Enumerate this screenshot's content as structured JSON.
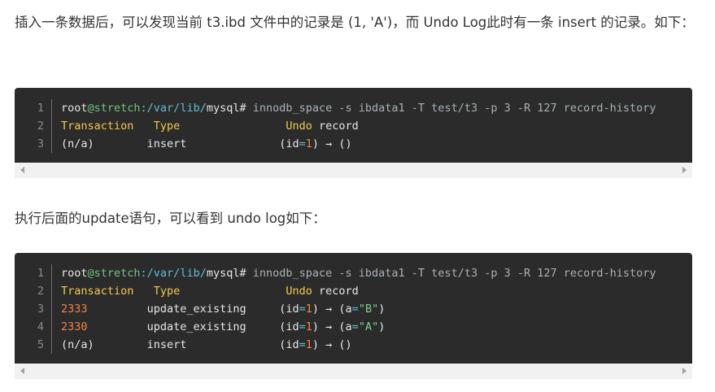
{
  "paragraphs": [
    "插入一条数据后，可以发现当前 t3.ibd 文件中的记录是 (1, 'A')，而 Undo Log此时有一条 insert 的记录。如下：",
    "执行后面的update语句，可以看到 undo log如下："
  ],
  "colors": {
    "plain": "#a9b1b6",
    "white": "#e6e6e6",
    "green": "#6ec77a",
    "teal": "#5fbfcf",
    "yellow": "#f2c94c",
    "orange": "#f0844a",
    "string": "#7ccf86"
  },
  "code_blocks": [
    {
      "lines": [
        [
          [
            "root",
            "white"
          ],
          [
            "@stretch",
            "green"
          ],
          [
            ":/var/lib/",
            "teal"
          ],
          [
            "mysql#",
            "white"
          ],
          [
            " innodb_space -s ibdata1 -T test/t3 -p 3 -R 127 record-history",
            "plain"
          ]
        ],
        [
          [
            "Transaction",
            "yellow"
          ],
          [
            "   ",
            "plain"
          ],
          [
            "Type",
            "yellow"
          ],
          [
            "                ",
            "plain"
          ],
          [
            "Undo",
            "yellow"
          ],
          [
            " record",
            "white"
          ]
        ],
        [
          [
            "(n/a)        insert              (id",
            "white"
          ],
          [
            "=",
            "teal"
          ],
          [
            "1",
            "orange"
          ],
          [
            ") → ()",
            "white"
          ]
        ]
      ]
    },
    {
      "lines": [
        [
          [
            "root",
            "white"
          ],
          [
            "@stretch",
            "green"
          ],
          [
            ":/var/lib/",
            "teal"
          ],
          [
            "mysql#",
            "white"
          ],
          [
            " innodb_space -s ibdata1 -T test/t3 -p 3 -R 127 record-history",
            "plain"
          ]
        ],
        [
          [
            "Transaction",
            "yellow"
          ],
          [
            "   ",
            "plain"
          ],
          [
            "Type",
            "yellow"
          ],
          [
            "                ",
            "plain"
          ],
          [
            "Undo",
            "yellow"
          ],
          [
            " record",
            "white"
          ]
        ],
        [
          [
            "2333",
            "orange"
          ],
          [
            "         update_existing     (id",
            "white"
          ],
          [
            "=",
            "teal"
          ],
          [
            "1",
            "orange"
          ],
          [
            ") → (a",
            "white"
          ],
          [
            "=",
            "teal"
          ],
          [
            "\"B\"",
            "string"
          ],
          [
            ")",
            "white"
          ]
        ],
        [
          [
            "2330",
            "orange"
          ],
          [
            "         update_existing     (id",
            "white"
          ],
          [
            "=",
            "teal"
          ],
          [
            "1",
            "orange"
          ],
          [
            ") → (a",
            "white"
          ],
          [
            "=",
            "teal"
          ],
          [
            "\"A\"",
            "string"
          ],
          [
            ")",
            "white"
          ]
        ],
        [
          [
            "(n/a)        insert              (id",
            "white"
          ],
          [
            "=",
            "teal"
          ],
          [
            "1",
            "orange"
          ],
          [
            ") → ()",
            "white"
          ]
        ]
      ]
    }
  ]
}
